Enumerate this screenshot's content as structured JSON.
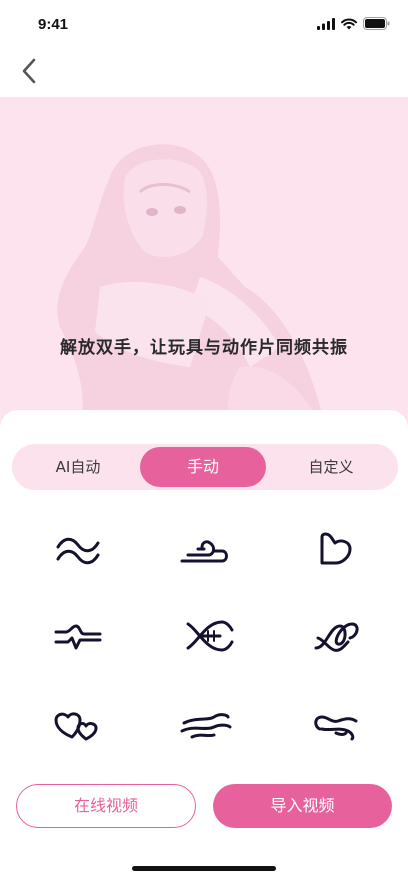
{
  "status_bar": {
    "time": "9:41"
  },
  "hero": {
    "caption": "解放双手，让玩具与动作片同频共振"
  },
  "mode_tabs": [
    {
      "label": "AI自动",
      "selected": false
    },
    {
      "label": "手动",
      "selected": true
    },
    {
      "label": "自定义",
      "selected": false
    }
  ],
  "patterns": [
    "wave-pattern-icon",
    "wind-pattern-icon",
    "heart-outline-pattern-icon",
    "pulse-pattern-icon",
    "fish-pattern-icon",
    "spiral-pattern-icon",
    "double-heart-pattern-icon",
    "breeze-pattern-icon",
    "ripple-pattern-icon"
  ],
  "actions": {
    "online_video": "在线视频",
    "import_video": "导入视频"
  },
  "colors": {
    "accent": "#e7629d",
    "hero_bg": "#fde3ee",
    "segment_bg": "#fbe2ed",
    "icon_stroke": "#14122e"
  }
}
